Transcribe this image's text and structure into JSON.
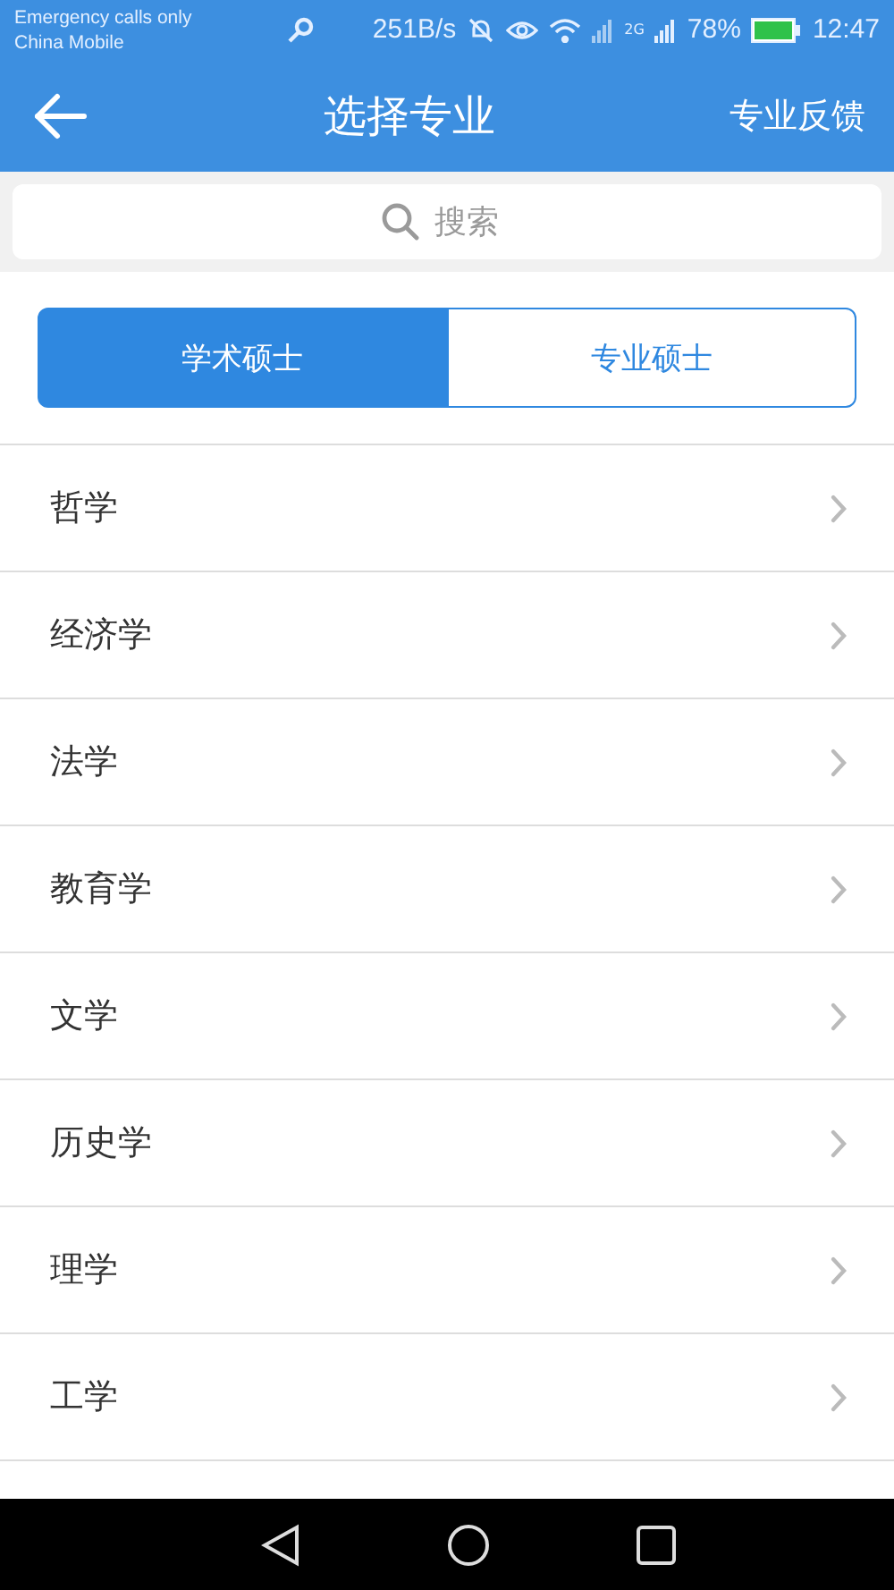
{
  "status_bar": {
    "carrier_lines": [
      "Emergency calls only",
      "China Mobile"
    ],
    "net_speed": "251B/s",
    "network_type": "2G",
    "battery": "78%",
    "time": "12:47"
  },
  "toolbar": {
    "title": "选择专业",
    "action": "专业反馈"
  },
  "search": {
    "placeholder": "搜索"
  },
  "segments": [
    {
      "label": "学术硕士",
      "selected": true
    },
    {
      "label": "专业硕士",
      "selected": false
    }
  ],
  "majors": [
    "哲学",
    "经济学",
    "法学",
    "教育学",
    "文学",
    "历史学",
    "理学",
    "工学"
  ]
}
